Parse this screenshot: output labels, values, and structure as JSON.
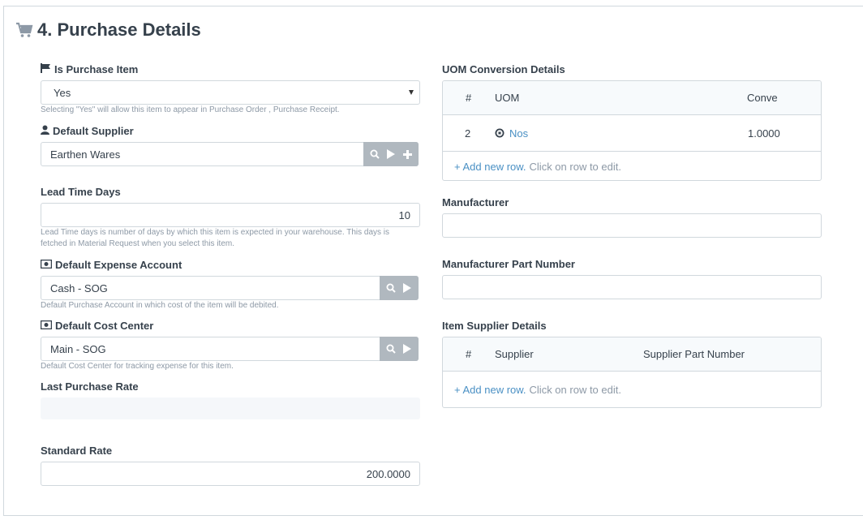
{
  "section": {
    "title": "4. Purchase Details",
    "icon": "shopping-cart-icon"
  },
  "left": {
    "is_purchase_item": {
      "label": "Is Purchase Item",
      "value": "Yes",
      "help": "Selecting \"Yes\" will allow this item to appear in Purchase Order , Purchase Receipt."
    },
    "default_supplier": {
      "label": "Default Supplier",
      "value": "Earthen Wares"
    },
    "lead_time_days": {
      "label": "Lead Time Days",
      "value": "10",
      "help": "Lead Time days is number of days by which this item is expected in your warehouse. This days is fetched in Material Request when you select this item."
    },
    "default_expense_account": {
      "label": "Default Expense Account",
      "value": "Cash - SOG",
      "help": "Default Purchase Account in which cost of the item will be debited."
    },
    "default_cost_center": {
      "label": "Default Cost Center",
      "value": "Main - SOG",
      "help": "Default Cost Center for tracking expense for this item."
    },
    "last_purchase_rate": {
      "label": "Last Purchase Rate",
      "value": ""
    },
    "standard_rate": {
      "label": "Standard Rate",
      "value": "200.0000"
    }
  },
  "right": {
    "uom_conversion": {
      "label": "UOM Conversion Details",
      "headers": {
        "num": "#",
        "uom": "UOM",
        "conv": "Conve"
      },
      "rows": [
        {
          "num": "2",
          "uom": "Nos",
          "conv": "1.0000"
        }
      ],
      "add_row": "+ Add new row.",
      "hint": "Click on row to edit."
    },
    "manufacturer": {
      "label": "Manufacturer",
      "value": ""
    },
    "manufacturer_part_number": {
      "label": "Manufacturer Part Number",
      "value": ""
    },
    "item_supplier": {
      "label": "Item Supplier Details",
      "headers": {
        "num": "#",
        "supplier": "Supplier",
        "part": "Supplier Part Number"
      },
      "add_row": "+ Add new row.",
      "hint": "Click on row to edit."
    }
  },
  "colors": {
    "border": "#d1d8dd",
    "link": "#4a90c4",
    "help_text": "#8d99a6",
    "button_gray": "#b0b8bf"
  }
}
